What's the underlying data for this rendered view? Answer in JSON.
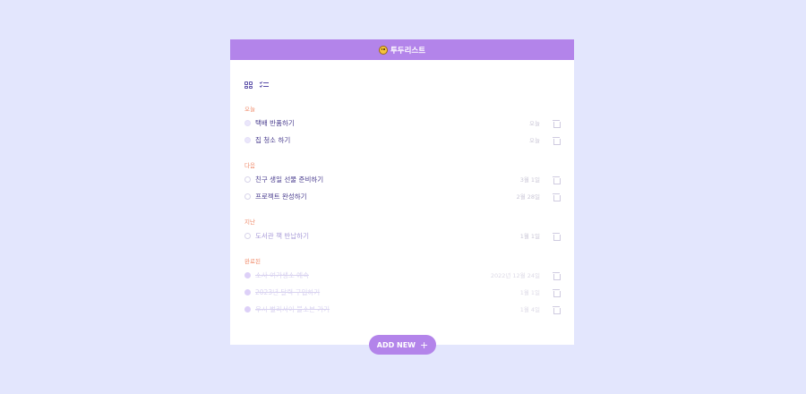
{
  "header": {
    "title": "투두리스트",
    "icon": "smiley-icon"
  },
  "view_toggles": [
    {
      "name": "grid-view",
      "icon": "grid-icon"
    },
    {
      "name": "list-view",
      "icon": "checklist-icon"
    }
  ],
  "sections": [
    {
      "title": "오늘",
      "items": [
        {
          "label": "택배 반품하기",
          "date": "오늘",
          "state": "today"
        },
        {
          "label": "집 청소 하기",
          "date": "오늘",
          "state": "today"
        }
      ]
    },
    {
      "title": "다음",
      "items": [
        {
          "label": "친구 생일 선물 준비하기",
          "date": "3월 1일",
          "state": "upcoming"
        },
        {
          "label": "프로젝트 완성하기",
          "date": "2월 28일",
          "state": "upcoming"
        }
      ]
    },
    {
      "title": "지난",
      "items": [
        {
          "label": "도서관 책 반납하기",
          "date": "1월 1일",
          "state": "past"
        }
      ]
    },
    {
      "title": "완료된",
      "items": [
        {
          "label": "소사 여가생소 예속",
          "date": "2022년 12월 24일",
          "state": "done"
        },
        {
          "label": "2023년 달력 구입하기",
          "date": "1월 1일",
          "state": "done"
        },
        {
          "label": "우시 벌리서이 불소본 가기",
          "date": "1월 4일",
          "state": "done"
        }
      ]
    }
  ],
  "add_button": {
    "label": "ADD NEW",
    "icon": "plus-icon"
  },
  "colors": {
    "background": "#e3e6fd",
    "accent": "#b384ea",
    "section_title": "#f08a6a",
    "item_text": "#4a3d8f"
  }
}
